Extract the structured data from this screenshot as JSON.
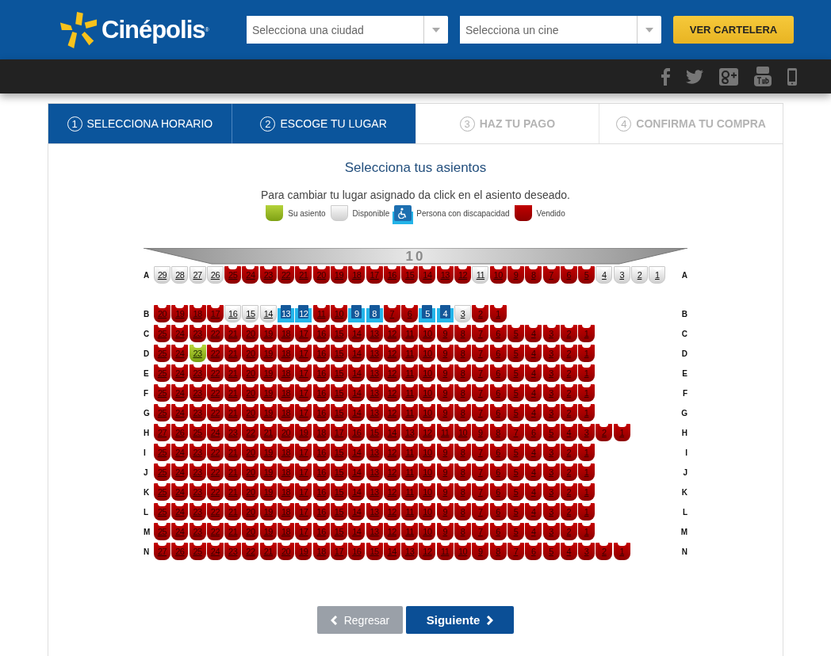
{
  "header": {
    "brand": "Cinépolis",
    "brand_mark": "®",
    "city_select": {
      "placeholder": "Selecciona una ciudad"
    },
    "cinema_select": {
      "placeholder": "Selecciona un cine"
    },
    "cta": "VER CARTELERA"
  },
  "steps": [
    {
      "number": "1",
      "label": "SELECCIONA HORARIO",
      "enabled": true
    },
    {
      "number": "2",
      "label": "ESCOGE TU LUGAR",
      "enabled": true
    },
    {
      "number": "3",
      "label": "HAZ TU PAGO",
      "enabled": false
    },
    {
      "number": "4",
      "label": "CONFIRMA TU COMPRA",
      "enabled": false
    }
  ],
  "title": "Selecciona tus asientos",
  "instruction": "Para cambiar tu lugar asignado da click en el asiento deseado.",
  "legend": [
    {
      "kind": "mine",
      "label": "Su asiento"
    },
    {
      "kind": "free",
      "label": "Disponible"
    },
    {
      "kind": "access",
      "label": "Persona con discapacidad"
    },
    {
      "kind": "sold",
      "label": "Vendido"
    }
  ],
  "screen_number": "10",
  "rows": [
    {
      "left_label": "A",
      "right_label": "A",
      "seats": [
        {
          "n": "29",
          "kind": "free"
        },
        {
          "n": "28",
          "kind": "free"
        },
        {
          "n": "27",
          "kind": "free"
        },
        {
          "n": "26",
          "kind": "free"
        },
        {
          "n": "25",
          "kind": "sold"
        },
        {
          "n": "24",
          "kind": "sold"
        },
        {
          "n": "23",
          "kind": "sold"
        },
        {
          "n": "22",
          "kind": "sold"
        },
        {
          "n": "21",
          "kind": "sold"
        },
        {
          "n": "20",
          "kind": "sold"
        },
        {
          "n": "19",
          "kind": "sold"
        },
        {
          "n": "18",
          "kind": "sold"
        },
        {
          "n": "17",
          "kind": "sold"
        },
        {
          "n": "16",
          "kind": "sold"
        },
        {
          "n": "15",
          "kind": "sold"
        },
        {
          "n": "14",
          "kind": "sold"
        },
        {
          "n": "13",
          "kind": "sold"
        },
        {
          "n": "12",
          "kind": "sold"
        },
        {
          "n": "11",
          "kind": "free"
        },
        {
          "n": "10",
          "kind": "sold"
        },
        {
          "n": "9",
          "kind": "sold"
        },
        {
          "n": "8",
          "kind": "sold"
        },
        {
          "n": "7",
          "kind": "sold"
        },
        {
          "n": "6",
          "kind": "sold"
        },
        {
          "n": "5",
          "kind": "sold"
        },
        {
          "n": "4",
          "kind": "free"
        },
        {
          "n": "3",
          "kind": "free"
        },
        {
          "n": "2",
          "kind": "free"
        },
        {
          "n": "1",
          "kind": "free"
        }
      ]
    },
    {
      "left_label": "B",
      "right_label": "B",
      "seats": [
        {
          "n": "20",
          "kind": "sold"
        },
        {
          "n": "19",
          "kind": "sold"
        },
        {
          "n": "18",
          "kind": "sold"
        },
        {
          "n": "17",
          "kind": "sold"
        },
        {
          "n": "16",
          "kind": "free"
        },
        {
          "n": "15",
          "kind": "free"
        },
        {
          "n": "14",
          "kind": "free"
        },
        {
          "n": "13",
          "kind": "access"
        },
        {
          "n": "12",
          "kind": "access"
        },
        {
          "n": "11",
          "kind": "sold"
        },
        {
          "n": "10",
          "kind": "sold"
        },
        {
          "n": "9",
          "kind": "access"
        },
        {
          "n": "8",
          "kind": "access"
        },
        {
          "n": "7",
          "kind": "sold"
        },
        {
          "n": "6",
          "kind": "sold"
        },
        {
          "n": "5",
          "kind": "access"
        },
        {
          "n": "4",
          "kind": "access"
        },
        {
          "n": "3",
          "kind": "free"
        },
        {
          "n": "2",
          "kind": "sold"
        },
        {
          "n": "1",
          "kind": "sold"
        }
      ]
    },
    {
      "left_label": "C",
      "right_label": "C",
      "seats": [
        {
          "n": "25",
          "kind": "sold"
        },
        {
          "n": "24",
          "kind": "sold"
        },
        {
          "n": "23",
          "kind": "sold"
        },
        {
          "n": "22",
          "kind": "sold"
        },
        {
          "n": "21",
          "kind": "sold"
        },
        {
          "n": "20",
          "kind": "sold"
        },
        {
          "n": "19",
          "kind": "sold"
        },
        {
          "n": "18",
          "kind": "sold"
        },
        {
          "n": "17",
          "kind": "sold"
        },
        {
          "n": "16",
          "kind": "sold"
        },
        {
          "n": "15",
          "kind": "sold"
        },
        {
          "n": "14",
          "kind": "sold"
        },
        {
          "n": "13",
          "kind": "sold"
        },
        {
          "n": "12",
          "kind": "sold"
        },
        {
          "n": "11",
          "kind": "sold"
        },
        {
          "n": "10",
          "kind": "sold"
        },
        {
          "n": "9",
          "kind": "sold"
        },
        {
          "n": "8",
          "kind": "sold"
        },
        {
          "n": "7",
          "kind": "sold"
        },
        {
          "n": "6",
          "kind": "sold"
        },
        {
          "n": "5",
          "kind": "sold"
        },
        {
          "n": "4",
          "kind": "sold"
        },
        {
          "n": "3",
          "kind": "sold"
        },
        {
          "n": "2",
          "kind": "sold"
        },
        {
          "n": "1",
          "kind": "sold"
        }
      ]
    },
    {
      "left_label": "D",
      "right_label": "D",
      "seats": [
        {
          "n": "25",
          "kind": "sold"
        },
        {
          "n": "24",
          "kind": "sold"
        },
        {
          "n": "23",
          "kind": "mine"
        },
        {
          "n": "22",
          "kind": "sold"
        },
        {
          "n": "21",
          "kind": "sold"
        },
        {
          "n": "20",
          "kind": "sold"
        },
        {
          "n": "19",
          "kind": "sold"
        },
        {
          "n": "18",
          "kind": "sold"
        },
        {
          "n": "17",
          "kind": "sold"
        },
        {
          "n": "16",
          "kind": "sold"
        },
        {
          "n": "15",
          "kind": "sold"
        },
        {
          "n": "14",
          "kind": "sold"
        },
        {
          "n": "13",
          "kind": "sold"
        },
        {
          "n": "12",
          "kind": "sold"
        },
        {
          "n": "11",
          "kind": "sold"
        },
        {
          "n": "10",
          "kind": "sold"
        },
        {
          "n": "9",
          "kind": "sold"
        },
        {
          "n": "8",
          "kind": "sold"
        },
        {
          "n": "7",
          "kind": "sold"
        },
        {
          "n": "6",
          "kind": "sold"
        },
        {
          "n": "5",
          "kind": "sold"
        },
        {
          "n": "4",
          "kind": "sold"
        },
        {
          "n": "3",
          "kind": "sold"
        },
        {
          "n": "2",
          "kind": "sold"
        },
        {
          "n": "1",
          "kind": "sold"
        }
      ]
    },
    {
      "left_label": "E",
      "right_label": "E",
      "seats": [
        {
          "n": "25",
          "kind": "sold"
        },
        {
          "n": "24",
          "kind": "sold"
        },
        {
          "n": "23",
          "kind": "sold"
        },
        {
          "n": "22",
          "kind": "sold"
        },
        {
          "n": "21",
          "kind": "sold"
        },
        {
          "n": "20",
          "kind": "sold"
        },
        {
          "n": "19",
          "kind": "sold"
        },
        {
          "n": "18",
          "kind": "sold"
        },
        {
          "n": "17",
          "kind": "sold"
        },
        {
          "n": "16",
          "kind": "sold"
        },
        {
          "n": "15",
          "kind": "sold"
        },
        {
          "n": "14",
          "kind": "sold"
        },
        {
          "n": "13",
          "kind": "sold"
        },
        {
          "n": "12",
          "kind": "sold"
        },
        {
          "n": "11",
          "kind": "sold"
        },
        {
          "n": "10",
          "kind": "sold"
        },
        {
          "n": "9",
          "kind": "sold"
        },
        {
          "n": "8",
          "kind": "sold"
        },
        {
          "n": "7",
          "kind": "sold"
        },
        {
          "n": "6",
          "kind": "sold"
        },
        {
          "n": "5",
          "kind": "sold"
        },
        {
          "n": "4",
          "kind": "sold"
        },
        {
          "n": "3",
          "kind": "sold"
        },
        {
          "n": "2",
          "kind": "sold"
        },
        {
          "n": "1",
          "kind": "sold"
        }
      ]
    },
    {
      "left_label": "F",
      "right_label": "F",
      "seats": [
        {
          "n": "25",
          "kind": "sold"
        },
        {
          "n": "24",
          "kind": "sold"
        },
        {
          "n": "23",
          "kind": "sold"
        },
        {
          "n": "22",
          "kind": "sold"
        },
        {
          "n": "21",
          "kind": "sold"
        },
        {
          "n": "20",
          "kind": "sold"
        },
        {
          "n": "19",
          "kind": "sold"
        },
        {
          "n": "18",
          "kind": "sold"
        },
        {
          "n": "17",
          "kind": "sold"
        },
        {
          "n": "16",
          "kind": "sold"
        },
        {
          "n": "15",
          "kind": "sold"
        },
        {
          "n": "14",
          "kind": "sold"
        },
        {
          "n": "13",
          "kind": "sold"
        },
        {
          "n": "12",
          "kind": "sold"
        },
        {
          "n": "11",
          "kind": "sold"
        },
        {
          "n": "10",
          "kind": "sold"
        },
        {
          "n": "9",
          "kind": "sold"
        },
        {
          "n": "8",
          "kind": "sold"
        },
        {
          "n": "7",
          "kind": "sold"
        },
        {
          "n": "6",
          "kind": "sold"
        },
        {
          "n": "5",
          "kind": "sold"
        },
        {
          "n": "4",
          "kind": "sold"
        },
        {
          "n": "3",
          "kind": "sold"
        },
        {
          "n": "2",
          "kind": "sold"
        },
        {
          "n": "1",
          "kind": "sold"
        }
      ]
    },
    {
      "left_label": "G",
      "right_label": "G",
      "seats": [
        {
          "n": "25",
          "kind": "sold"
        },
        {
          "n": "24",
          "kind": "sold"
        },
        {
          "n": "23",
          "kind": "sold"
        },
        {
          "n": "22",
          "kind": "sold"
        },
        {
          "n": "21",
          "kind": "sold"
        },
        {
          "n": "20",
          "kind": "sold"
        },
        {
          "n": "19",
          "kind": "sold"
        },
        {
          "n": "18",
          "kind": "sold"
        },
        {
          "n": "17",
          "kind": "sold"
        },
        {
          "n": "16",
          "kind": "sold"
        },
        {
          "n": "15",
          "kind": "sold"
        },
        {
          "n": "14",
          "kind": "sold"
        },
        {
          "n": "13",
          "kind": "sold"
        },
        {
          "n": "12",
          "kind": "sold"
        },
        {
          "n": "11",
          "kind": "sold"
        },
        {
          "n": "10",
          "kind": "sold"
        },
        {
          "n": "9",
          "kind": "sold"
        },
        {
          "n": "8",
          "kind": "sold"
        },
        {
          "n": "7",
          "kind": "sold"
        },
        {
          "n": "6",
          "kind": "sold"
        },
        {
          "n": "5",
          "kind": "sold"
        },
        {
          "n": "4",
          "kind": "sold"
        },
        {
          "n": "3",
          "kind": "sold"
        },
        {
          "n": "2",
          "kind": "sold"
        },
        {
          "n": "1",
          "kind": "sold"
        }
      ]
    },
    {
      "left_label": "H",
      "right_label": "H",
      "seats": [
        {
          "n": "27",
          "kind": "sold"
        },
        {
          "n": "26",
          "kind": "sold"
        },
        {
          "n": "25",
          "kind": "sold"
        },
        {
          "n": "24",
          "kind": "sold"
        },
        {
          "n": "23",
          "kind": "sold"
        },
        {
          "n": "22",
          "kind": "sold"
        },
        {
          "n": "21",
          "kind": "sold"
        },
        {
          "n": "20",
          "kind": "sold"
        },
        {
          "n": "19",
          "kind": "sold"
        },
        {
          "n": "18",
          "kind": "sold"
        },
        {
          "n": "17",
          "kind": "sold"
        },
        {
          "n": "16",
          "kind": "sold"
        },
        {
          "n": "15",
          "kind": "sold"
        },
        {
          "n": "14",
          "kind": "sold"
        },
        {
          "n": "13",
          "kind": "sold"
        },
        {
          "n": "12",
          "kind": "sold"
        },
        {
          "n": "11",
          "kind": "sold"
        },
        {
          "n": "10",
          "kind": "sold"
        },
        {
          "n": "9",
          "kind": "sold"
        },
        {
          "n": "8",
          "kind": "sold"
        },
        {
          "n": "7",
          "kind": "sold"
        },
        {
          "n": "6",
          "kind": "sold"
        },
        {
          "n": "5",
          "kind": "sold"
        },
        {
          "n": "4",
          "kind": "sold"
        },
        {
          "n": "3",
          "kind": "sold"
        },
        {
          "n": "2",
          "kind": "sold"
        },
        {
          "n": "1",
          "kind": "sold"
        }
      ]
    },
    {
      "left_label": "I",
      "right_label": "I",
      "seats": [
        {
          "n": "25",
          "kind": "sold"
        },
        {
          "n": "24",
          "kind": "sold"
        },
        {
          "n": "23",
          "kind": "sold"
        },
        {
          "n": "22",
          "kind": "sold"
        },
        {
          "n": "21",
          "kind": "sold"
        },
        {
          "n": "20",
          "kind": "sold"
        },
        {
          "n": "19",
          "kind": "sold"
        },
        {
          "n": "18",
          "kind": "sold"
        },
        {
          "n": "17",
          "kind": "sold"
        },
        {
          "n": "16",
          "kind": "sold"
        },
        {
          "n": "15",
          "kind": "sold"
        },
        {
          "n": "14",
          "kind": "sold"
        },
        {
          "n": "13",
          "kind": "sold"
        },
        {
          "n": "12",
          "kind": "sold"
        },
        {
          "n": "11",
          "kind": "sold"
        },
        {
          "n": "10",
          "kind": "sold"
        },
        {
          "n": "9",
          "kind": "sold"
        },
        {
          "n": "8",
          "kind": "sold"
        },
        {
          "n": "7",
          "kind": "sold"
        },
        {
          "n": "6",
          "kind": "sold"
        },
        {
          "n": "5",
          "kind": "sold"
        },
        {
          "n": "4",
          "kind": "sold"
        },
        {
          "n": "3",
          "kind": "sold"
        },
        {
          "n": "2",
          "kind": "sold"
        },
        {
          "n": "1",
          "kind": "sold"
        }
      ]
    },
    {
      "left_label": "J",
      "right_label": "J",
      "seats": [
        {
          "n": "25",
          "kind": "sold"
        },
        {
          "n": "24",
          "kind": "sold"
        },
        {
          "n": "23",
          "kind": "sold"
        },
        {
          "n": "22",
          "kind": "sold"
        },
        {
          "n": "21",
          "kind": "sold"
        },
        {
          "n": "20",
          "kind": "sold"
        },
        {
          "n": "19",
          "kind": "sold"
        },
        {
          "n": "18",
          "kind": "sold"
        },
        {
          "n": "17",
          "kind": "sold"
        },
        {
          "n": "16",
          "kind": "sold"
        },
        {
          "n": "15",
          "kind": "sold"
        },
        {
          "n": "14",
          "kind": "sold"
        },
        {
          "n": "13",
          "kind": "sold"
        },
        {
          "n": "12",
          "kind": "sold"
        },
        {
          "n": "11",
          "kind": "sold"
        },
        {
          "n": "10",
          "kind": "sold"
        },
        {
          "n": "9",
          "kind": "sold"
        },
        {
          "n": "8",
          "kind": "sold"
        },
        {
          "n": "7",
          "kind": "sold"
        },
        {
          "n": "6",
          "kind": "sold"
        },
        {
          "n": "5",
          "kind": "sold"
        },
        {
          "n": "4",
          "kind": "sold"
        },
        {
          "n": "3",
          "kind": "sold"
        },
        {
          "n": "2",
          "kind": "sold"
        },
        {
          "n": "1",
          "kind": "sold"
        }
      ]
    },
    {
      "left_label": "K",
      "right_label": "K",
      "seats": [
        {
          "n": "25",
          "kind": "sold"
        },
        {
          "n": "24",
          "kind": "sold"
        },
        {
          "n": "23",
          "kind": "sold"
        },
        {
          "n": "22",
          "kind": "sold"
        },
        {
          "n": "21",
          "kind": "sold"
        },
        {
          "n": "20",
          "kind": "sold"
        },
        {
          "n": "19",
          "kind": "sold"
        },
        {
          "n": "18",
          "kind": "sold"
        },
        {
          "n": "17",
          "kind": "sold"
        },
        {
          "n": "16",
          "kind": "sold"
        },
        {
          "n": "15",
          "kind": "sold"
        },
        {
          "n": "14",
          "kind": "sold"
        },
        {
          "n": "13",
          "kind": "sold"
        },
        {
          "n": "12",
          "kind": "sold"
        },
        {
          "n": "11",
          "kind": "sold"
        },
        {
          "n": "10",
          "kind": "sold"
        },
        {
          "n": "9",
          "kind": "sold"
        },
        {
          "n": "8",
          "kind": "sold"
        },
        {
          "n": "7",
          "kind": "sold"
        },
        {
          "n": "6",
          "kind": "sold"
        },
        {
          "n": "5",
          "kind": "sold"
        },
        {
          "n": "4",
          "kind": "sold"
        },
        {
          "n": "3",
          "kind": "sold"
        },
        {
          "n": "2",
          "kind": "sold"
        },
        {
          "n": "1",
          "kind": "sold"
        }
      ]
    },
    {
      "left_label": "L",
      "right_label": "L",
      "seats": [
        {
          "n": "25",
          "kind": "sold"
        },
        {
          "n": "24",
          "kind": "sold"
        },
        {
          "n": "23",
          "kind": "sold"
        },
        {
          "n": "22",
          "kind": "sold"
        },
        {
          "n": "21",
          "kind": "sold"
        },
        {
          "n": "20",
          "kind": "sold"
        },
        {
          "n": "19",
          "kind": "sold"
        },
        {
          "n": "18",
          "kind": "sold"
        },
        {
          "n": "17",
          "kind": "sold"
        },
        {
          "n": "16",
          "kind": "sold"
        },
        {
          "n": "15",
          "kind": "sold"
        },
        {
          "n": "14",
          "kind": "sold"
        },
        {
          "n": "13",
          "kind": "sold"
        },
        {
          "n": "12",
          "kind": "sold"
        },
        {
          "n": "11",
          "kind": "sold"
        },
        {
          "n": "10",
          "kind": "sold"
        },
        {
          "n": "9",
          "kind": "sold"
        },
        {
          "n": "8",
          "kind": "sold"
        },
        {
          "n": "7",
          "kind": "sold"
        },
        {
          "n": "6",
          "kind": "sold"
        },
        {
          "n": "5",
          "kind": "sold"
        },
        {
          "n": "4",
          "kind": "sold"
        },
        {
          "n": "3",
          "kind": "sold"
        },
        {
          "n": "2",
          "kind": "sold"
        },
        {
          "n": "1",
          "kind": "sold"
        }
      ]
    },
    {
      "left_label": "M",
      "right_label": "M",
      "seats": [
        {
          "n": "25",
          "kind": "sold"
        },
        {
          "n": "24",
          "kind": "sold"
        },
        {
          "n": "23",
          "kind": "sold"
        },
        {
          "n": "22",
          "kind": "sold"
        },
        {
          "n": "21",
          "kind": "sold"
        },
        {
          "n": "20",
          "kind": "sold"
        },
        {
          "n": "19",
          "kind": "sold"
        },
        {
          "n": "18",
          "kind": "sold"
        },
        {
          "n": "17",
          "kind": "sold"
        },
        {
          "n": "16",
          "kind": "sold"
        },
        {
          "n": "15",
          "kind": "sold"
        },
        {
          "n": "14",
          "kind": "sold"
        },
        {
          "n": "13",
          "kind": "sold"
        },
        {
          "n": "12",
          "kind": "sold"
        },
        {
          "n": "11",
          "kind": "sold"
        },
        {
          "n": "10",
          "kind": "sold"
        },
        {
          "n": "9",
          "kind": "sold"
        },
        {
          "n": "8",
          "kind": "sold"
        },
        {
          "n": "7",
          "kind": "sold"
        },
        {
          "n": "6",
          "kind": "sold"
        },
        {
          "n": "5",
          "kind": "sold"
        },
        {
          "n": "4",
          "kind": "sold"
        },
        {
          "n": "3",
          "kind": "sold"
        },
        {
          "n": "2",
          "kind": "sold"
        },
        {
          "n": "1",
          "kind": "sold"
        }
      ]
    },
    {
      "left_label": "N",
      "right_label": "N",
      "seats": [
        {
          "n": "27",
          "kind": "sold"
        },
        {
          "n": "26",
          "kind": "sold"
        },
        {
          "n": "25",
          "kind": "sold"
        },
        {
          "n": "24",
          "kind": "sold"
        },
        {
          "n": "23",
          "kind": "sold"
        },
        {
          "n": "22",
          "kind": "sold"
        },
        {
          "n": "21",
          "kind": "sold"
        },
        {
          "n": "20",
          "kind": "sold"
        },
        {
          "n": "19",
          "kind": "sold"
        },
        {
          "n": "18",
          "kind": "sold"
        },
        {
          "n": "17",
          "kind": "sold"
        },
        {
          "n": "16",
          "kind": "sold"
        },
        {
          "n": "15",
          "kind": "sold"
        },
        {
          "n": "14",
          "kind": "sold"
        },
        {
          "n": "13",
          "kind": "sold"
        },
        {
          "n": "12",
          "kind": "sold"
        },
        {
          "n": "11",
          "kind": "sold"
        },
        {
          "n": "10",
          "kind": "sold"
        },
        {
          "n": "9",
          "kind": "sold"
        },
        {
          "n": "8",
          "kind": "sold"
        },
        {
          "n": "7",
          "kind": "sold"
        },
        {
          "n": "6",
          "kind": "sold"
        },
        {
          "n": "5",
          "kind": "sold"
        },
        {
          "n": "4",
          "kind": "sold"
        },
        {
          "n": "3",
          "kind": "sold"
        },
        {
          "n": "2",
          "kind": "sold"
        },
        {
          "n": "1",
          "kind": "sold"
        }
      ]
    }
  ],
  "back_button": "Regresar",
  "next_button": "Siguiente"
}
